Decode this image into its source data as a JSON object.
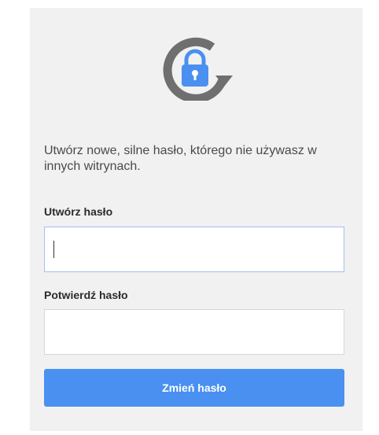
{
  "icon": {
    "name": "lock-refresh-icon",
    "ring_color": "#6f6f6f",
    "lock_color": "#4a90f0"
  },
  "message": "Utwórz nowe, silne hasło, którego nie używasz w innych witrynach.",
  "create_password": {
    "label": "Utwórz hasło",
    "value": ""
  },
  "confirm_password": {
    "label": "Potwierdź hasło",
    "value": ""
  },
  "submit_label": "Zmień hasło",
  "colors": {
    "accent": "#4a90f0",
    "card_background": "#f1f1f1",
    "focused_border": "#9fc0f0"
  }
}
